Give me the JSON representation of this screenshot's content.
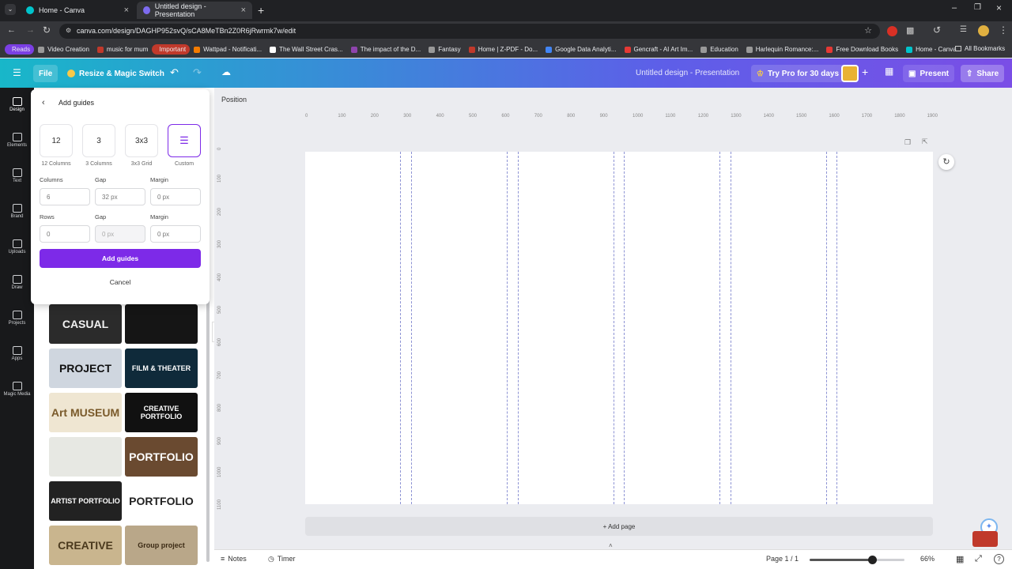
{
  "browser": {
    "tabs": [
      {
        "title": "Home - Canva",
        "active": false
      },
      {
        "title": "Untitled design - Presentation",
        "active": true
      }
    ],
    "new_tab": "+",
    "url": "canva.com/design/DAGHP952svQ/sCA8MeTBn2Z0R6jRwrmk7w/edit",
    "bookmarks": [
      {
        "label": "Reads",
        "color": "#7b3fe4"
      },
      {
        "label": "Video Creation",
        "color": "#999"
      },
      {
        "label": "music for mum",
        "color": "#c0392b"
      },
      {
        "label": "Important",
        "color": "#c0392b"
      },
      {
        "label": "Wattpad - Notificati...",
        "color": "#f57c00"
      },
      {
        "label": "The Wall Street Cras...",
        "color": "#fff"
      },
      {
        "label": "The impact of the D...",
        "color": "#8e44ad"
      },
      {
        "label": "Fantasy",
        "color": "#999"
      },
      {
        "label": "Home | Z-PDF - Do...",
        "color": "#c0392b"
      },
      {
        "label": "Google Data Analyti...",
        "color": "#4285f4"
      },
      {
        "label": "Gencraft - AI Art Im...",
        "color": "#e53935"
      },
      {
        "label": "Education",
        "color": "#999"
      },
      {
        "label": "Harlequin Romance:...",
        "color": "#999"
      },
      {
        "label": "Free Download Books",
        "color": "#e53935"
      },
      {
        "label": "Home - Canva",
        "color": "#00c4cc"
      }
    ],
    "all_bookmarks": "All Bookmarks"
  },
  "header": {
    "file": "File",
    "resize": "Resize & Magic Switch",
    "design_title": "Untitled design - Presentation",
    "try_pro": "Try Pro for 30 days",
    "present": "Present",
    "share": "Share"
  },
  "rail": [
    {
      "label": "Design",
      "icon": "design-icon"
    },
    {
      "label": "Elements",
      "icon": "elements-icon"
    },
    {
      "label": "Text",
      "icon": "text-icon"
    },
    {
      "label": "Brand",
      "icon": "brand-icon"
    },
    {
      "label": "Uploads",
      "icon": "uploads-icon"
    },
    {
      "label": "Draw",
      "icon": "draw-icon"
    },
    {
      "label": "Projects",
      "icon": "projects-icon"
    },
    {
      "label": "Apps",
      "icon": "apps-icon"
    },
    {
      "label": "Magic Media",
      "icon": "magic-media-icon"
    }
  ],
  "guides": {
    "title": "Add guides",
    "presets": [
      {
        "value": "12",
        "label": "12 Columns"
      },
      {
        "value": "3",
        "label": "3 Columns"
      },
      {
        "value": "3x3",
        "label": "3x3 Grid"
      },
      {
        "value": "",
        "label": "Custom"
      }
    ],
    "columns_label": "Columns",
    "columns_value": "6",
    "col_gap_label": "Gap",
    "col_gap_value": "32 px",
    "col_margin_label": "Margin",
    "col_margin_value": "0 px",
    "rows_label": "Rows",
    "rows_value": "0",
    "row_gap_label": "Gap",
    "row_gap_value": "0 px",
    "row_margin_label": "Margin",
    "row_margin_value": "0 px",
    "add_button": "Add guides",
    "cancel_button": "Cancel"
  },
  "templates": [
    {
      "text": "CASUAL",
      "bg": "#2b2b2b",
      "fg": "#f2f2f2"
    },
    {
      "text": "",
      "bg": "#151515",
      "fg": "#e53935"
    },
    {
      "text": "PROJECT",
      "bg": "#cfd6df",
      "fg": "#111"
    },
    {
      "text": "FILM & THEATER",
      "bg": "#0f2a3a",
      "fg": "#fff"
    },
    {
      "text": "Art MUSEUM",
      "bg": "#efe6d2",
      "fg": "#7a5a2a"
    },
    {
      "text": "CREATIVE PORTFOLIO",
      "bg": "#111",
      "fg": "#fff"
    },
    {
      "text": "",
      "bg": "#e7e8e3",
      "fg": "#555"
    },
    {
      "text": "PORTFOLIO",
      "bg": "#6a4a30",
      "fg": "#fff"
    },
    {
      "text": "ARTIST PORTFOLIO",
      "bg": "#222",
      "fg": "#fff"
    },
    {
      "text": "PORTFOLIO",
      "bg": "#ffffff",
      "fg": "#222"
    },
    {
      "text": "CREATIVE",
      "bg": "#c9b58e",
      "fg": "#4b3a1e"
    },
    {
      "text": "Group project",
      "bg": "#b9a789",
      "fg": "#3b2a14"
    }
  ],
  "editor": {
    "position_label": "Position",
    "ruler_top": [
      "0",
      "100",
      "200",
      "300",
      "400",
      "500",
      "600",
      "700",
      "800",
      "900",
      "1000",
      "1100",
      "1200",
      "1300",
      "1400",
      "1500",
      "1600",
      "1700",
      "1800",
      "1900"
    ],
    "ruler_left": [
      "0",
      "100",
      "200",
      "300",
      "400",
      "500",
      "600",
      "700",
      "800",
      "900",
      "1000",
      "1100"
    ],
    "add_page": "+ Add page"
  },
  "footer": {
    "notes": "Notes",
    "timer": "Timer",
    "page": "Page 1 / 1",
    "zoom": "66%",
    "zoom_fraction": 0.66
  }
}
